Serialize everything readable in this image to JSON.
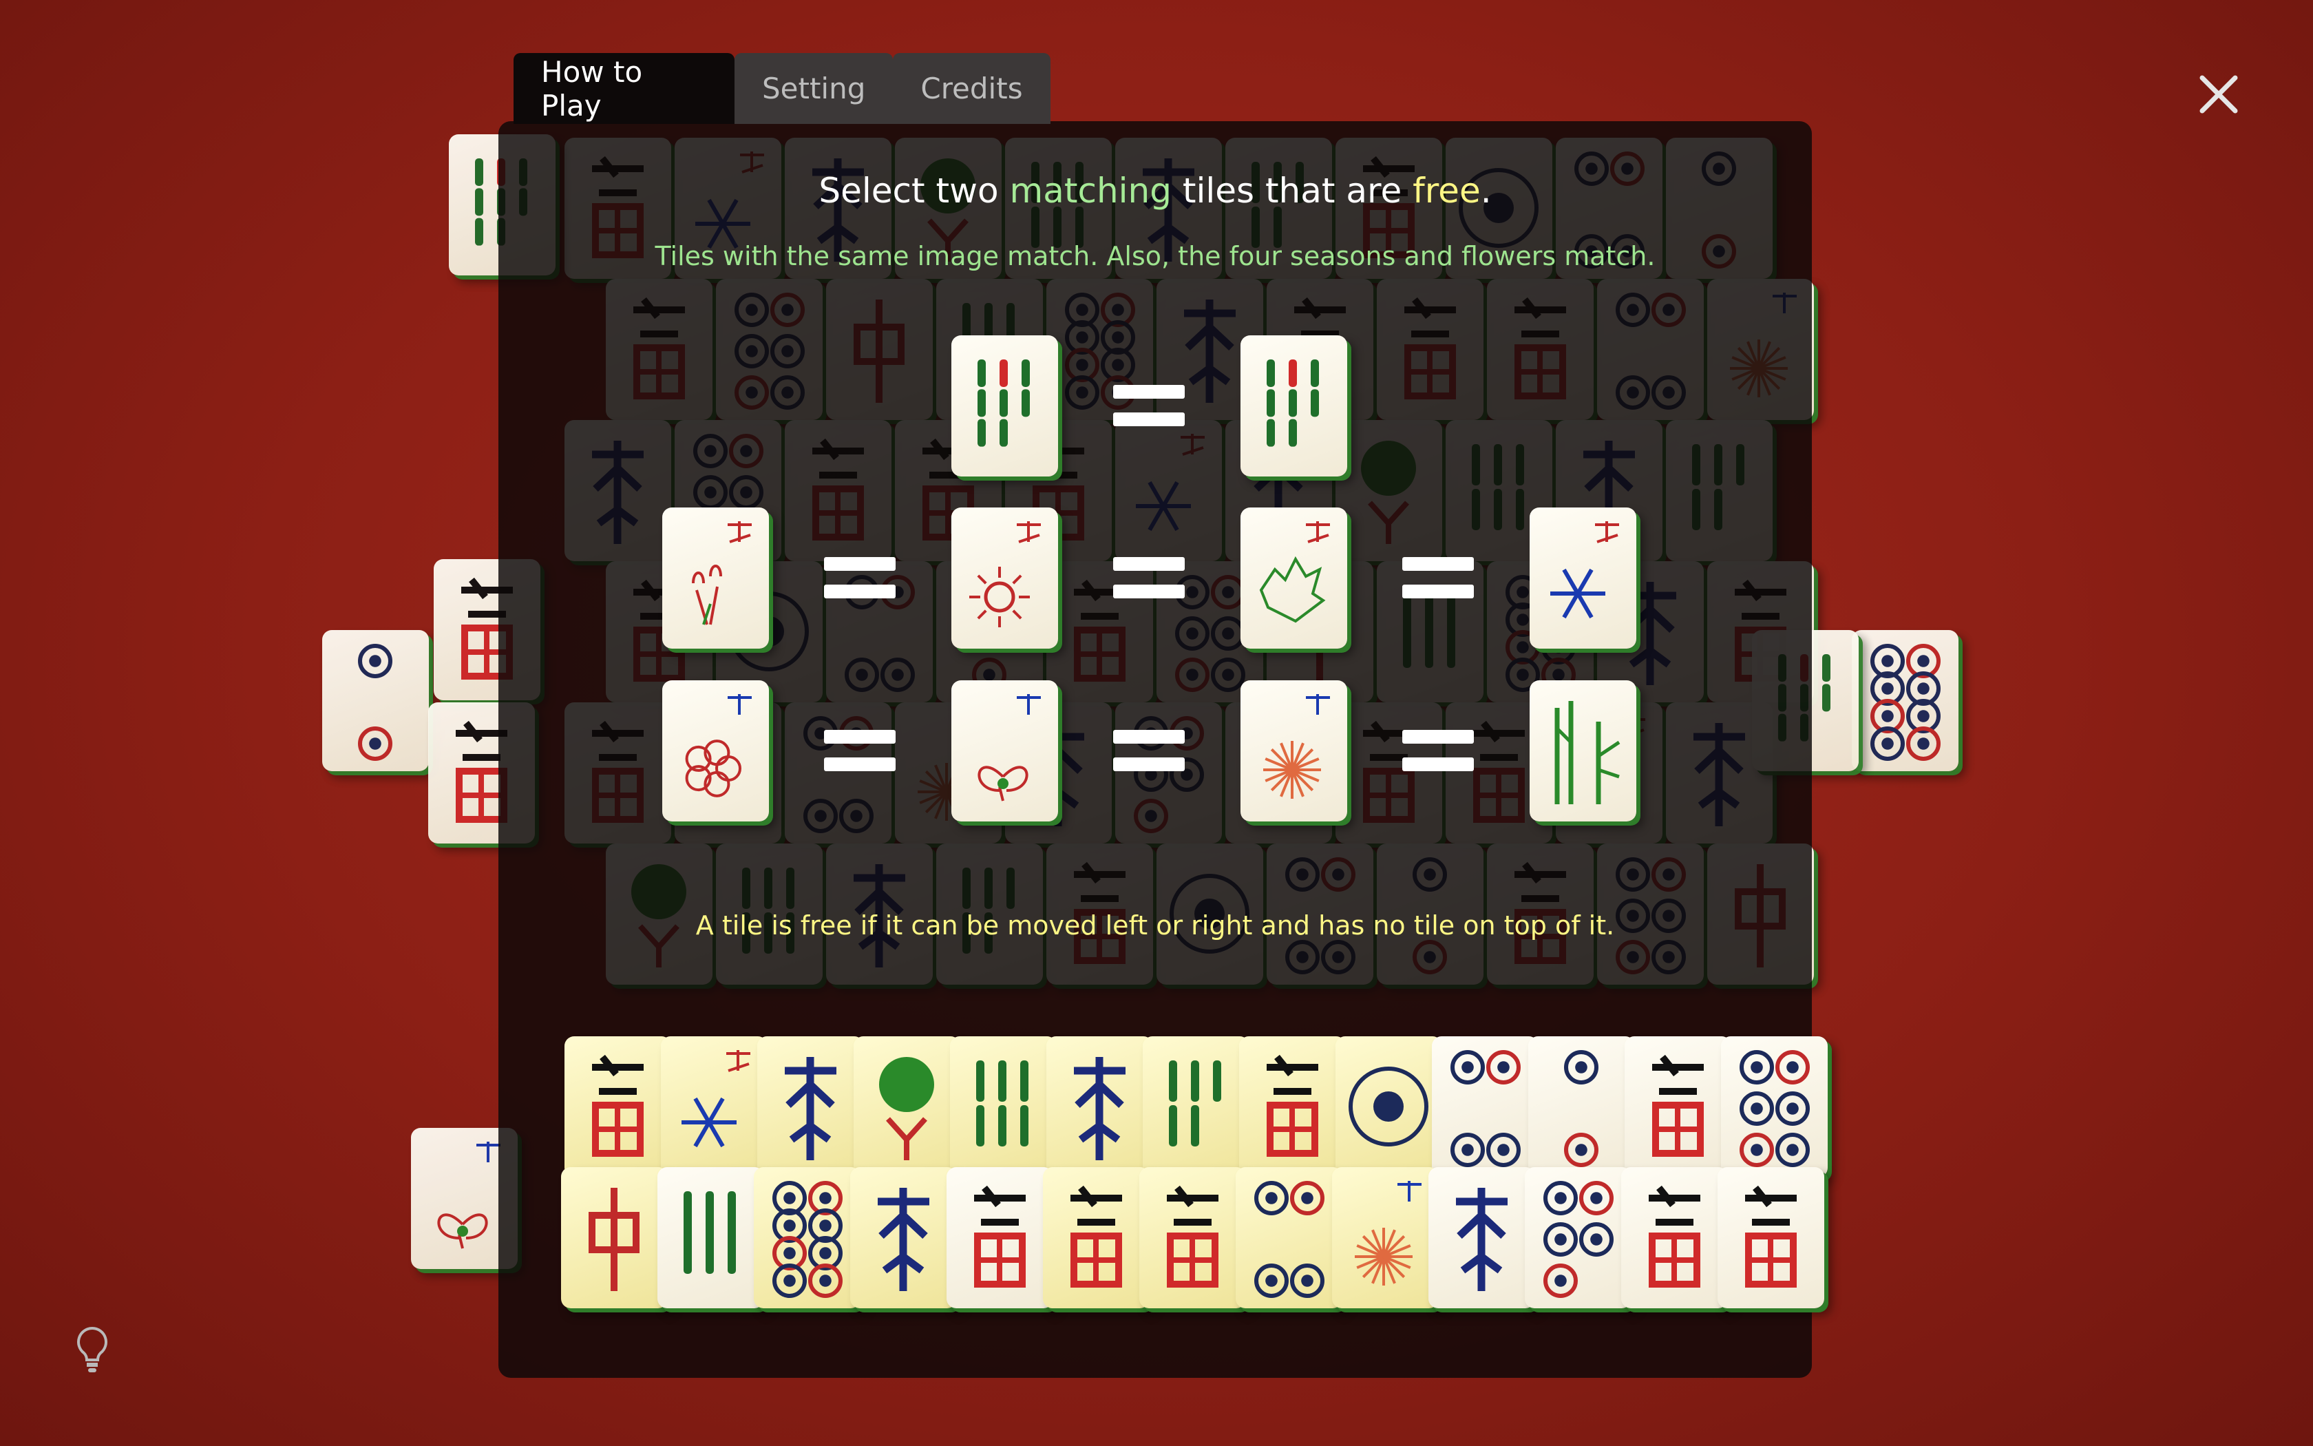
{
  "tabs": [
    {
      "label": "How to Play",
      "active": true
    },
    {
      "label": "Setting",
      "active": false
    },
    {
      "label": "Credits",
      "active": false
    }
  ],
  "howto": {
    "title_parts": [
      "Select two ",
      "matching",
      " tiles that are ",
      "free",
      "."
    ],
    "subtitle": "Tiles with the same image match.  Also, the four seasons and flowers match.",
    "rule": "A tile is free if it can be moved left or right and has no tile on top of it.",
    "examples": [
      [
        "bamboo-8",
        "bamboo-8"
      ],
      [
        "season-spring",
        "season-summer",
        "season-autumn",
        "season-winter"
      ],
      [
        "flower-plum",
        "flower-orchid",
        "flower-chrysanthemum",
        "flower-bamboo"
      ]
    ],
    "equals_icon": "equals-icon"
  },
  "board_tiles_bottom": [
    "character-3",
    "season-winter",
    "wind-south",
    "bird-bamboo-1",
    "bamboo-6",
    "wind-west",
    "bamboo-5",
    "character-5",
    "circle-1",
    "circle-4",
    "circle-2",
    "character-8",
    "circle-6",
    "dragon-red",
    "bamboo-3",
    "circle-8",
    "wind-east",
    "character-9",
    "character-2",
    "character-7",
    "circle-4",
    "flower-chrysanthemum",
    "wind-east",
    "circle-5",
    "character-8",
    "character-2"
  ],
  "board_tiles_side": [
    "circle-2",
    "character-5",
    "character-5",
    "bamboo-8",
    "circle-8",
    "bamboo-8",
    "flower-orchid"
  ],
  "colors": {
    "felt": "#8c1f15",
    "panel": "#0c0808",
    "accent_green": "#a6ea97",
    "accent_yellow": "#fdf685",
    "tile_edge": "#2f7d2a"
  },
  "icons": {
    "close": "close-icon",
    "hint": "lightbulb-icon"
  }
}
